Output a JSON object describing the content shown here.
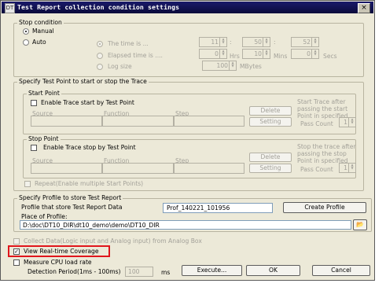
{
  "window": {
    "title": "Test Report collection condition settings",
    "close_glyph": "×"
  },
  "stop": {
    "group_title": "Stop condition",
    "manual": "Manual",
    "auto": "Auto",
    "time_is": "The time is ...",
    "time_h": "11",
    "time_m": "50",
    "time_s": "52",
    "elapsed": "Elapsed time is ....",
    "el_h": "0",
    "el_m": "10",
    "el_s": "0",
    "hrs": "Hrs",
    "mins": "Mins",
    "secs": "Secs",
    "log_size": "Log size",
    "log_val": "100",
    "mbytes": "MBytes"
  },
  "trace": {
    "group_title": "Specify Test Point to start or stop the Trace",
    "start_title": "Start Point",
    "enable_start": "Enable Trace start by Test Point",
    "stop_title": "Stop Point",
    "enable_stop": "Enable Trace stop by Test Point",
    "col_source": "Source",
    "col_function": "Function",
    "col_step": "Step",
    "delete": "Delete",
    "setting": "Setting",
    "start_note": "Start Trace after passing the start Point in specified",
    "stop_note": "Stop the trace after passing the stop Point in specified",
    "pass_count": "Pass Count",
    "pass_val": "1",
    "repeat": "Repeat(Enable multiple Start Points)"
  },
  "profile": {
    "group_title": "Specify Profile to store Test Report",
    "label": "Profile that store Test Report Data",
    "name": "Prof_140221_101956",
    "create": "Create Profile",
    "place_label": "Place of Profile:",
    "path": "D:\\doc\\DT10_DIR\\dt10_demo\\demo\\DT10_DIR"
  },
  "bottom": {
    "collect": "Collect Data(Logic input and Analog input) from Analog Box",
    "view_rt": "View Real-time Coverage",
    "measure_cpu": "Measure CPU load rate",
    "detection": "Detection Period(1ms - 100ms)",
    "detection_val": "100",
    "ms": "ms",
    "execute": "Execute...",
    "ok": "OK",
    "cancel": "Cancel"
  },
  "colors": {
    "dialog_bg": "#ece9d8",
    "title_bg": "#0a0a3a",
    "highlight": "#e0161c",
    "disabled_text": "#a3a199"
  }
}
